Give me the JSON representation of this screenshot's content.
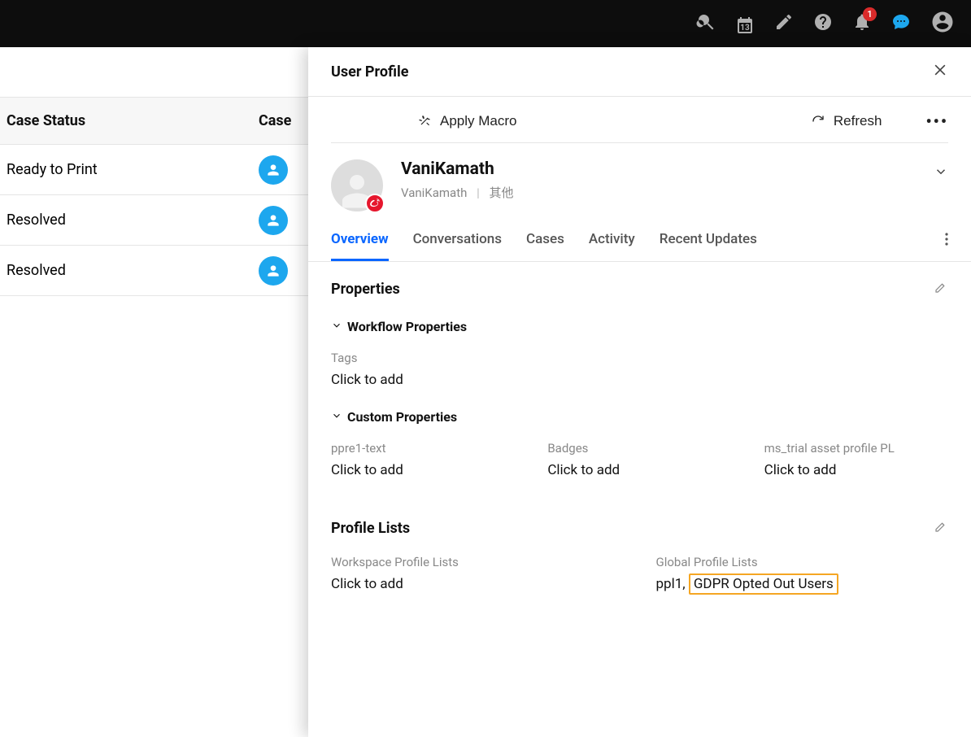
{
  "topbar": {
    "calendar_day": "13",
    "notification_count": "1"
  },
  "table": {
    "headers": {
      "col1": "Case Status",
      "col2": "Case"
    },
    "rows": [
      {
        "status": "Ready to Print"
      },
      {
        "status": "Resolved"
      },
      {
        "status": "Resolved"
      }
    ]
  },
  "panel": {
    "title": "User Profile",
    "actions": {
      "apply_macro": "Apply Macro",
      "refresh": "Refresh"
    },
    "identity": {
      "display_name": "VaniKamath",
      "username": "VaniKamath",
      "extra": "其他"
    },
    "tabs": [
      "Overview",
      "Conversations",
      "Cases",
      "Activity",
      "Recent Updates"
    ],
    "active_tab": "Overview",
    "properties": {
      "section_title": "Properties",
      "workflow": {
        "title": "Workflow Properties",
        "fields": [
          {
            "label": "Tags",
            "value": "Click to add"
          }
        ]
      },
      "custom": {
        "title": "Custom Properties",
        "fields": [
          {
            "label": "ppre1-text",
            "value": "Click to add"
          },
          {
            "label": "Badges",
            "value": "Click to add"
          },
          {
            "label": "ms_trial asset profile PL",
            "value": "Click to add"
          }
        ]
      }
    },
    "profile_lists": {
      "section_title": "Profile Lists",
      "workspace": {
        "label": "Workspace Profile Lists",
        "value": "Click to add"
      },
      "global": {
        "label": "Global Profile Lists",
        "prefix": "ppl1, ",
        "highlighted": "GDPR Opted Out Users"
      }
    }
  }
}
